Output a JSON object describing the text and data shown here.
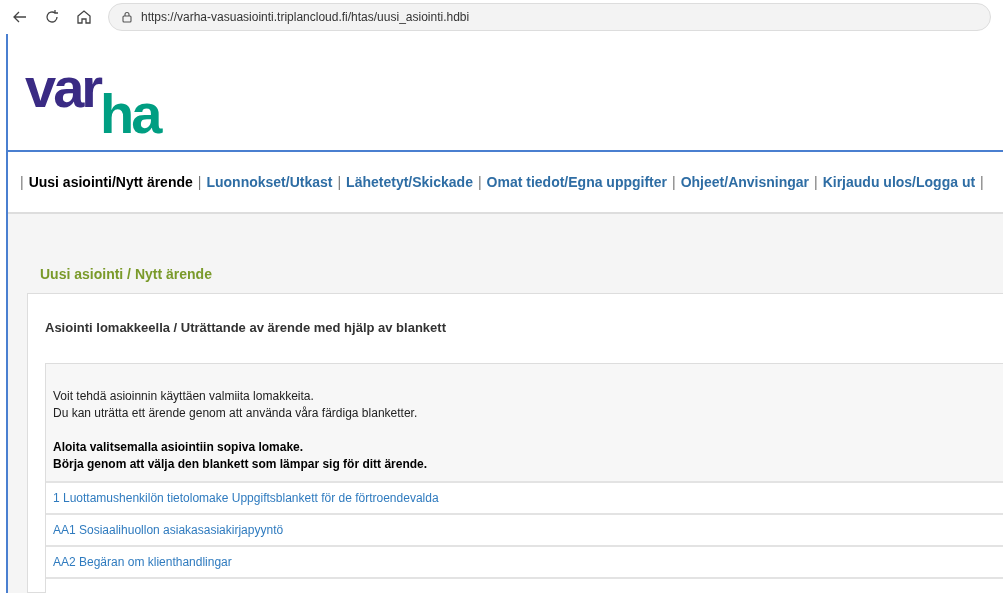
{
  "browser": {
    "url": "https://varha-vasuasiointi.triplancloud.fi/htas/uusi_asiointi.hdbi"
  },
  "logo": {
    "part_1": "var",
    "part_2": "ha"
  },
  "nav": [
    {
      "label": "Uusi asiointi/Nytt ärende",
      "selected": true
    },
    {
      "label": "Luonnokset/Utkast",
      "selected": false
    },
    {
      "label": "Lähetetyt/Skickade",
      "selected": false
    },
    {
      "label": "Omat tiedot/Egna uppgifter",
      "selected": false
    },
    {
      "label": "Ohjeet/Anvisningar",
      "selected": false
    },
    {
      "label": "Kirjaudu ulos/Logga ut",
      "selected": false
    }
  ],
  "nav_separator": "|",
  "page_title": "Uusi asiointi / Nytt ärende",
  "card": {
    "heading": "Asiointi lomakkeella / Uträttande av ärende med hjälp av blankett",
    "intro": [
      "Voit tehdä asioinnin käyttäen valmiita lomakkeita.",
      "Du kan uträtta ett ärende genom att använda våra färdiga blanketter."
    ],
    "instruction": [
      "Aloita valitsemalla asiointiin sopiva lomake.",
      "Börja genom att välja den blankett som lämpar sig för ditt ärende."
    ],
    "forms": [
      "1 Luottamushenkilön tietolomake Uppgiftsblankett för de förtroendevalda",
      "AA1 Sosiaalihuollon asiakasasiakirjapyyntö",
      "AA2 Begäran om klienthandlingar"
    ]
  }
}
